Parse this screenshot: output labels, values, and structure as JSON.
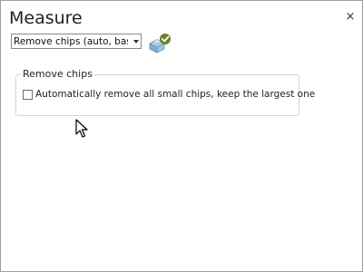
{
  "panel": {
    "title": "Measure",
    "close_glyph": "×",
    "close_icon": "close-icon"
  },
  "mode_select": {
    "selected_value": "Remove chips (auto, based"
  },
  "tool_icon": {
    "name": "measure-tool-checked-icon",
    "accent_color": "#3a9ad9",
    "check_color": "#4a8f2f"
  },
  "remove_chips_group": {
    "legend": "Remove chips",
    "auto_remove_option": {
      "label": "Automatically remove all small chips, keep the largest one",
      "checked": false
    }
  }
}
